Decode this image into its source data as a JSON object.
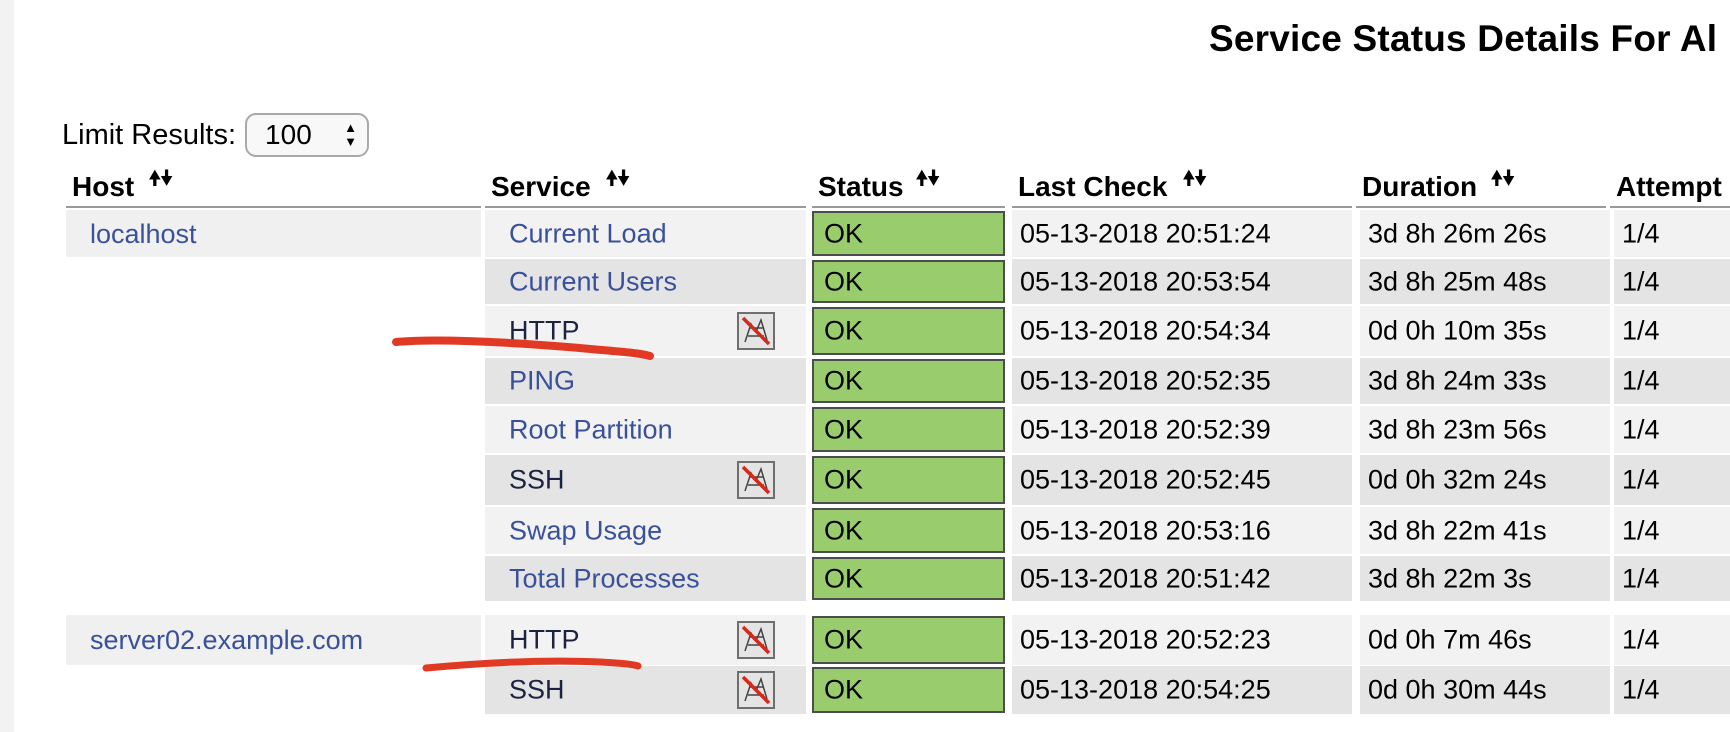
{
  "page": {
    "title": "Service Status Details For Al"
  },
  "limit": {
    "label": "Limit Results:",
    "value": "100"
  },
  "sort_icons": {
    "up": "🠝",
    "down": "🠟"
  },
  "columns": [
    {
      "label": "Host"
    },
    {
      "label": "Service"
    },
    {
      "label": "Status"
    },
    {
      "label": "Last Check"
    },
    {
      "label": "Duration"
    },
    {
      "label": "Attempt"
    }
  ],
  "hosts": [
    {
      "name": "localhost"
    },
    {
      "name": "server02.example.com"
    }
  ],
  "rows": [
    {
      "service": "Current Load",
      "notifications_disabled": false,
      "status": "OK",
      "last_check": "05-13-2018 20:51:24",
      "duration": "3d 8h 26m 26s",
      "attempt": "1/4"
    },
    {
      "service": "Current Users",
      "notifications_disabled": false,
      "status": "OK",
      "last_check": "05-13-2018 20:53:54",
      "duration": "3d 8h 25m 48s",
      "attempt": "1/4"
    },
    {
      "service": "HTTP",
      "notifications_disabled": true,
      "status": "OK",
      "last_check": "05-13-2018 20:54:34",
      "duration": "0d 0h 10m 35s",
      "attempt": "1/4"
    },
    {
      "service": "PING",
      "notifications_disabled": false,
      "status": "OK",
      "last_check": "05-13-2018 20:52:35",
      "duration": "3d 8h 24m 33s",
      "attempt": "1/4"
    },
    {
      "service": "Root Partition",
      "notifications_disabled": false,
      "status": "OK",
      "last_check": "05-13-2018 20:52:39",
      "duration": "3d 8h 23m 56s",
      "attempt": "1/4"
    },
    {
      "service": "SSH",
      "notifications_disabled": true,
      "status": "OK",
      "last_check": "05-13-2018 20:52:45",
      "duration": "0d 0h 32m 24s",
      "attempt": "1/4"
    },
    {
      "service": "Swap Usage",
      "notifications_disabled": false,
      "status": "OK",
      "last_check": "05-13-2018 20:53:16",
      "duration": "3d 8h 22m 41s",
      "attempt": "1/4"
    },
    {
      "service": "Total Processes",
      "notifications_disabled": false,
      "status": "OK",
      "last_check": "05-13-2018 20:51:42",
      "duration": "3d 8h 22m 3s",
      "attempt": "1/4"
    },
    {
      "service": "HTTP",
      "notifications_disabled": true,
      "status": "OK",
      "last_check": "05-13-2018 20:52:23",
      "duration": "0d 0h 7m 46s",
      "attempt": "1/4"
    },
    {
      "service": "SSH",
      "notifications_disabled": true,
      "status": "OK",
      "last_check": "05-13-2018 20:54:25",
      "duration": "0d 0h 30m 44s",
      "attempt": "1/4"
    }
  ],
  "colors": {
    "ok": "#98cc6c",
    "link": "#39519b",
    "annotation": "#e03a24"
  }
}
